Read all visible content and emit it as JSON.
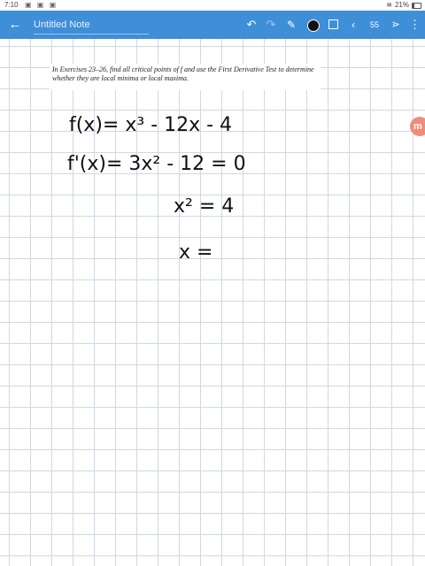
{
  "status_bar": {
    "time": "7:10",
    "left_icons": "▣ ▣ ▣",
    "battery": "21%"
  },
  "toolbar": {
    "back_icon": "←",
    "note_title": "Untitled Note",
    "undo_icon": "↶",
    "redo_icon": "↷",
    "pen_icon": "✎",
    "prev_icon": "‹",
    "page_number": "55",
    "add_page_icon": "⋗",
    "more_icon": "⋮",
    "pen_color": "#111111"
  },
  "excerpt": {
    "text": "In Exercises 23–26, find all critical points of f and use the First Derivative Test to determine whether they are local minima or local maxima."
  },
  "handwriting": {
    "line1": "f(x)= x³ - 12x - 4",
    "line2": "f'(x)= 3x² - 12 = 0",
    "line3": "x² = 4",
    "line4": "x ="
  },
  "side_tab": {
    "letter": "m"
  }
}
